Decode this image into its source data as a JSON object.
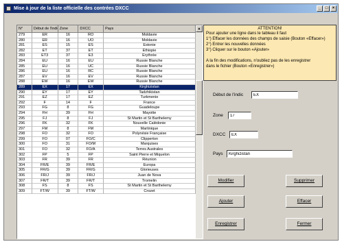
{
  "window": {
    "title": "Mise à jour de la liste officielle des contrées DXCC"
  },
  "grid": {
    "headers": [
      "N°",
      "Début de l'indic",
      "Zone",
      "DXCC",
      "Pays"
    ],
    "rows": [
      [
        "279",
        "ER",
        "16",
        "RO",
        "Moldavie"
      ],
      [
        "280",
        "ER",
        "16",
        "UO",
        "Moldavie"
      ],
      [
        "281",
        "ES",
        "15",
        "ES",
        "Estonie"
      ],
      [
        "282",
        "ET",
        "37",
        "ET",
        "Ethiopie"
      ],
      [
        "283",
        "ET3",
        "37",
        "E3",
        "Erythrée"
      ],
      [
        "284",
        "EU",
        "16",
        "EU",
        "Russie Blanche"
      ],
      [
        "285",
        "EU",
        "16",
        "UC",
        "Russie Blanche"
      ],
      [
        "286",
        "EU",
        "16",
        "RC",
        "Russie Blanche"
      ],
      [
        "287",
        "EV",
        "16",
        "EV",
        "Russie Blanche"
      ],
      [
        "288",
        "EW",
        "16",
        "EW",
        "Russie Blanche"
      ],
      [
        "289",
        "EX",
        "17",
        "EX",
        "Kirghizistan"
      ],
      [
        "290",
        "EY",
        "17",
        "EY",
        "Tadzhikistan"
      ],
      [
        "291",
        "EZ",
        "17",
        "EZ",
        "Turkmenie"
      ],
      [
        "292",
        "F",
        "14",
        "F",
        "France"
      ],
      [
        "293",
        "FG",
        "8",
        "FG",
        "Guadeloupe"
      ],
      [
        "294",
        "FH",
        "39",
        "FH",
        "Mayotte"
      ],
      [
        "295",
        "FJ",
        "8",
        "FJ",
        "St Martin et St Barthelemy"
      ],
      [
        "296",
        "FK",
        "32",
        "FK",
        "Nouvelle Calédonie"
      ],
      [
        "297",
        "FM",
        "8",
        "FM",
        "Martinique"
      ],
      [
        "298",
        "FO",
        "32",
        "FO",
        "Polynésie Française"
      ],
      [
        "299",
        "FO",
        "07",
        "FO/C",
        "Clipperton"
      ],
      [
        "300",
        "FO",
        "31",
        "FO/M",
        "Marquises"
      ],
      [
        "301",
        "FO",
        "32",
        "FO/A",
        "Terres Australes"
      ],
      [
        "302",
        "FP",
        "5",
        "FP",
        "Saint Pierre et Miquelon"
      ],
      [
        "303",
        "FR",
        "39",
        "FR",
        "Réunion"
      ],
      [
        "304",
        "FR/E",
        "39",
        "FR/E",
        "Europa"
      ],
      [
        "305",
        "FR/G",
        "39",
        "FR/G",
        "Glorieuses"
      ],
      [
        "306",
        "FR/J",
        "39",
        "FR/J",
        "Juan de Nova"
      ],
      [
        "307",
        "FR/T",
        "39",
        "FR/T",
        "Tromelin"
      ],
      [
        "308",
        "FS",
        "8",
        "FS",
        "St Martin et St Barthelemy"
      ],
      [
        "309",
        "FT/W",
        "39",
        "FT/W",
        "Crozet"
      ]
    ],
    "selected_index": 10
  },
  "note": {
    "title": "ATTENTION!",
    "lines": [
      "Pour ajouter une ligne dans le tableau il faut",
      "1°) Effacer les données des champs de saisie (Bouton «Effacer»)",
      "2°) Entrer les nouvelles données",
      "3°) Cliquer sur le bouton «Ajouter»",
      "",
      "A la fin des modifications, n'oubliez pas de les enregistrer",
      "dans le fichier (Bouton «Enregistrer»)"
    ]
  },
  "form": {
    "indic_label": "Début de l'indic",
    "indic_value": "EX",
    "zone_label": "Zone",
    "zone_value": "17",
    "dxcc_label": "DXCC",
    "dxcc_value": "EX",
    "pays_label": "Pays",
    "pays_value": "Kirghizistan"
  },
  "buttons": {
    "modifier": "Modifier",
    "supprimer": "Supprimer",
    "ajouter": "Ajouter",
    "effacer": "Effacer",
    "enregistrer": "Enregistrer",
    "fermer": "Fermer"
  },
  "icons": {
    "scroll_up": "scroll-up-arrow-icon",
    "close": "close-icon",
    "minimize": "minimize-icon",
    "maximize": "maximize-icon"
  }
}
